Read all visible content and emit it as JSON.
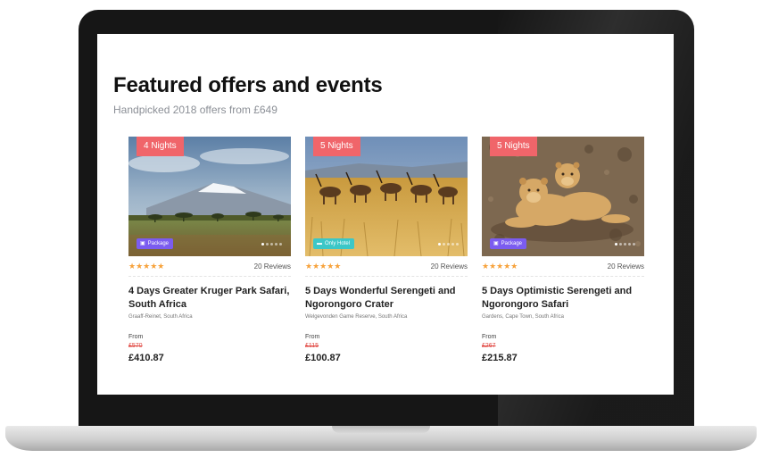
{
  "page": {
    "heading": "Featured offers and events",
    "subheading": "Handpicked 2018 offers from £649"
  },
  "colors": {
    "nights_badge": "#f0656a",
    "package_badge": "#7b5cf0",
    "hotel_badge": "#3cc7c7",
    "stars": "#f7a23b",
    "old_price": "#e0443e"
  },
  "cards": [
    {
      "nights": "4 Nights",
      "type_label": "Package",
      "type_icon": "package-icon",
      "stars": "★★★★★",
      "reviews": "20 Reviews",
      "title": "4 Days Greater Kruger Park Safari, South Africa",
      "location": "Graaff-Reinet, South Africa",
      "from_label": "From",
      "old_price": "£570",
      "price": "£410.87",
      "image": "mountain-savanna-photo"
    },
    {
      "nights": "5 Nights",
      "type_label": "Only Hotel",
      "type_icon": "bed-icon",
      "stars": "★★★★★",
      "reviews": "20 Reviews",
      "title": "5 Days Wonderful Serengeti and Ngorongoro Crater",
      "location": "Welgevonden Game Reserve, South Africa",
      "from_label": "From",
      "old_price": "£115",
      "price": "£100.87",
      "image": "antelope-grassland-photo"
    },
    {
      "nights": "5 Nights",
      "type_label": "Package",
      "type_icon": "package-icon",
      "stars": "★★★★★",
      "reviews": "20 Reviews",
      "title": "5 Days Optimistic Serengeti and Ngorongoro Safari",
      "location": "Gardens, Cape Town, South Africa",
      "from_label": "From",
      "old_price": "£267",
      "price": "£215.87",
      "image": "lion-cubs-photo"
    }
  ]
}
